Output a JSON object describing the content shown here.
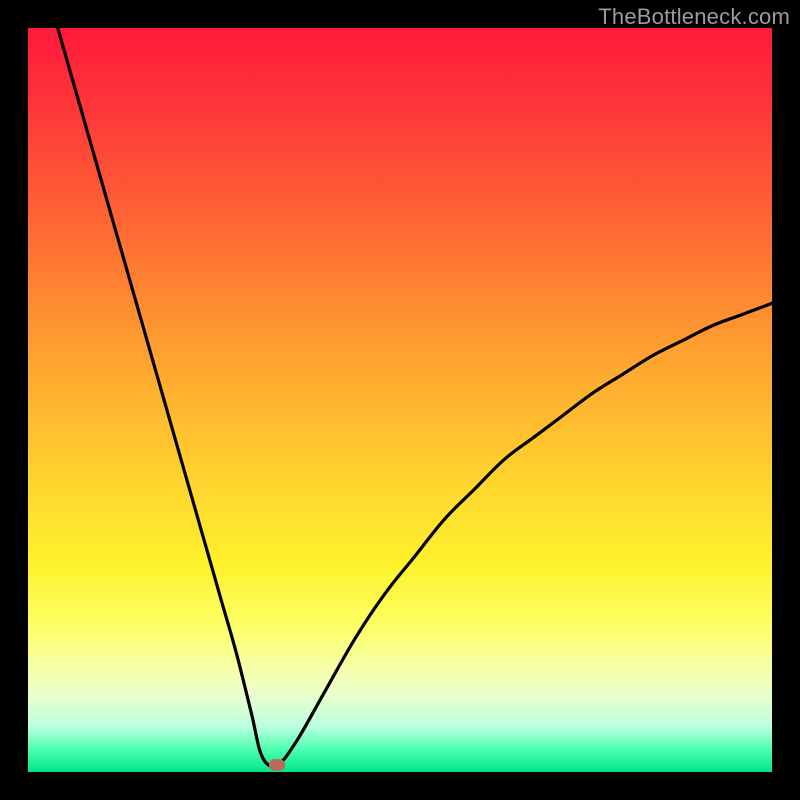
{
  "watermark": {
    "text": "TheBottleneck.com"
  },
  "chart_data": {
    "type": "line",
    "title": "",
    "xlabel": "",
    "ylabel": "",
    "xlim": [
      0,
      100
    ],
    "ylim": [
      0,
      100
    ],
    "grid": false,
    "legend": false,
    "series": [
      {
        "name": "bottleneck-curve",
        "x": [
          4,
          6,
          8,
          10,
          12,
          14,
          16,
          18,
          20,
          22,
          24,
          26,
          28,
          30,
          31.5,
          33.5,
          36,
          40,
          44,
          48,
          52,
          56,
          60,
          64,
          68,
          72,
          76,
          80,
          84,
          88,
          92,
          96,
          100
        ],
        "values": [
          100,
          93,
          86,
          79,
          72,
          65,
          58,
          51,
          44,
          37,
          30,
          23,
          16,
          8,
          2,
          1,
          4,
          11,
          18,
          24,
          29,
          34,
          38,
          42,
          45,
          48,
          51,
          53.5,
          56,
          58,
          60,
          61.5,
          63
        ]
      }
    ],
    "marker": {
      "x": 33.5,
      "y": 1
    },
    "colors": {
      "curve": "#000000",
      "marker": "#bb6a57",
      "gradient_top": "#ff1a3a",
      "gradient_bottom": "#00e58a"
    }
  }
}
